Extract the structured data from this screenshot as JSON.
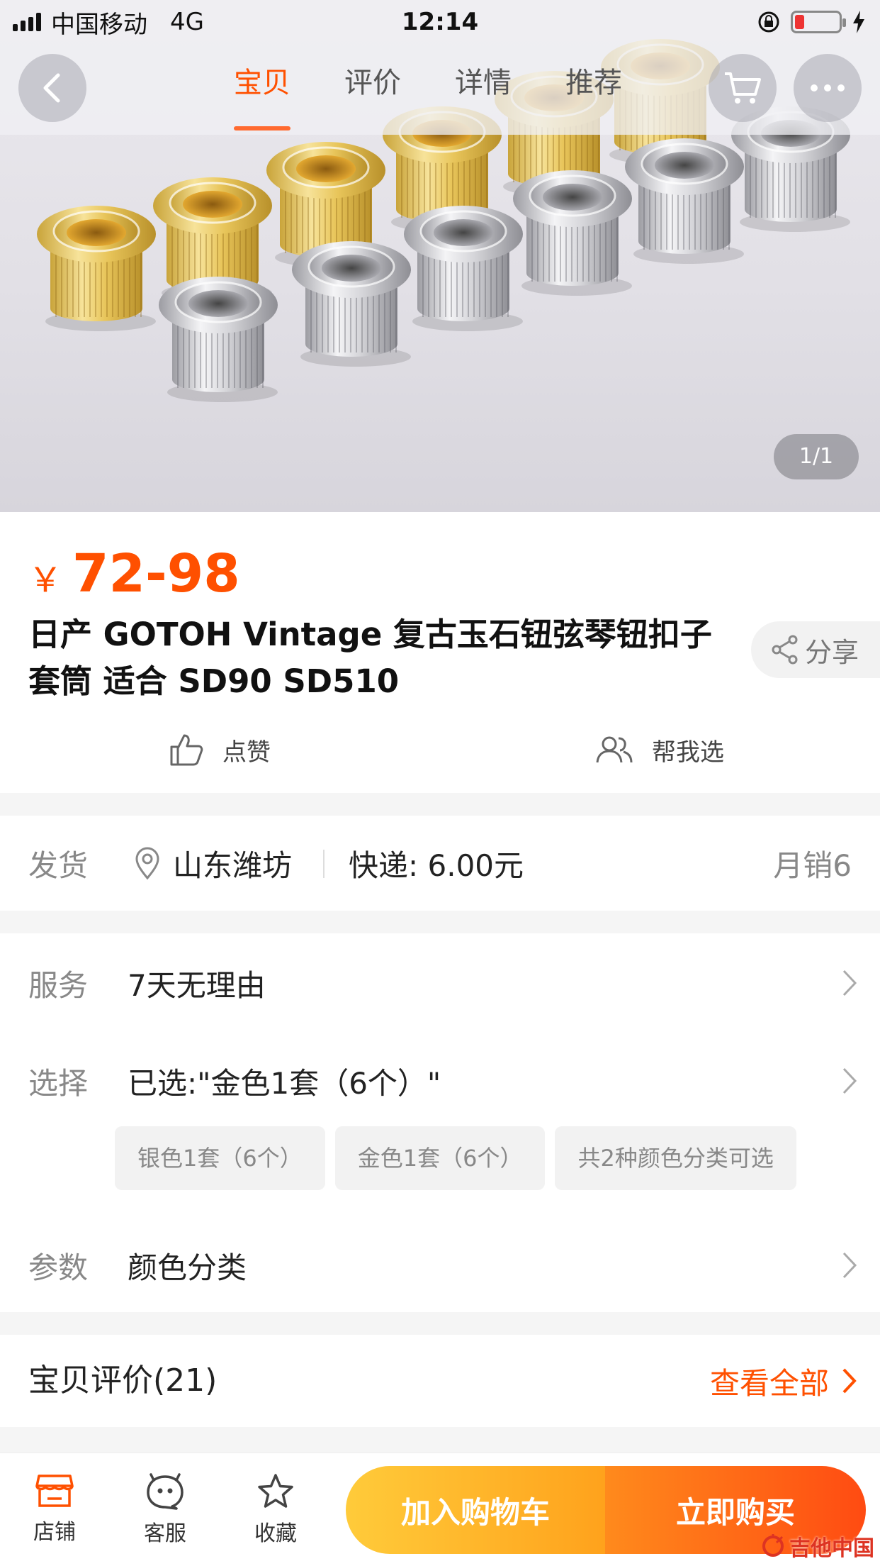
{
  "status_bar": {
    "carrier": "中国移动",
    "network": "4G",
    "time": "12:14"
  },
  "nav": {
    "tabs": [
      "宝贝",
      "评价",
      "详情",
      "推荐"
    ],
    "active_tab": "宝贝"
  },
  "gallery": {
    "pager": "1/1"
  },
  "product": {
    "currency": "￥",
    "price": "72-98",
    "title": "日产 GOTOH  Vintage 复古玉石钮弦琴钮扣子套筒 适合 SD90 SD510",
    "share_label": "分享"
  },
  "social": {
    "like_label": "点赞",
    "help_choose_label": "帮我选"
  },
  "shipping": {
    "label": "发货",
    "origin": "山东潍坊",
    "express": "快递: 6.00元",
    "monthly_sales": "月销6"
  },
  "service": {
    "label": "服务",
    "value": "7天无理由",
    "select_label": "选择",
    "selected": "已选:\"金色1套（6个）\"",
    "options": [
      "银色1套（6个）",
      "金色1套（6个）",
      "共2种颜色分类可选"
    ],
    "params_label": "参数",
    "params_value": "颜色分类"
  },
  "reviews": {
    "title": "宝贝评价(21)",
    "view_all": "查看全部"
  },
  "bottom_bar": {
    "shop": "店铺",
    "service": "客服",
    "favorite": "收藏",
    "add_to_cart": "加入购物车",
    "buy_now": "立即购买"
  },
  "watermark": {
    "text": "吉他中国"
  },
  "colors": {
    "accent": "#ff5000",
    "cart_button": "#ffb22a",
    "buy_button": "#ff5a14"
  }
}
